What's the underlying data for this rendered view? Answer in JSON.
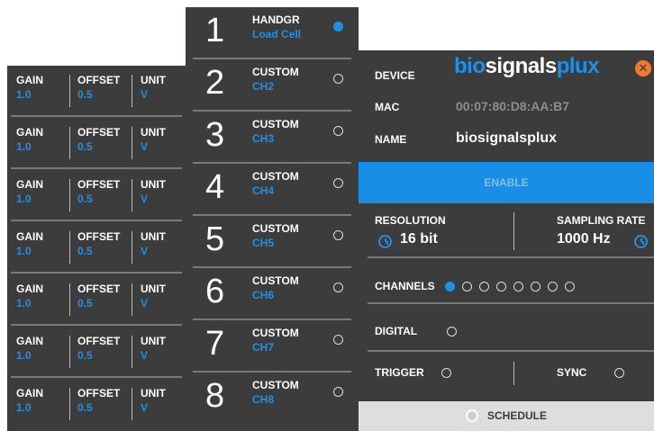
{
  "channel_config": [
    {
      "gain_label": "GAIN",
      "gain_value": "1.0",
      "offset_label": "OFFSET",
      "offset_value": "0.5",
      "unit_label": "UNIT",
      "unit_value": "V"
    },
    {
      "gain_label": "GAIN",
      "gain_value": "1.0",
      "offset_label": "OFFSET",
      "offset_value": "0.5",
      "unit_label": "UNIT",
      "unit_value": "V"
    },
    {
      "gain_label": "GAIN",
      "gain_value": "1.0",
      "offset_label": "OFFSET",
      "offset_value": "0.5",
      "unit_label": "UNIT",
      "unit_value": "V"
    },
    {
      "gain_label": "GAIN",
      "gain_value": "1.0",
      "offset_label": "OFFSET",
      "offset_value": "0.5",
      "unit_label": "UNIT",
      "unit_value": "V"
    },
    {
      "gain_label": "GAIN",
      "gain_value": "1.0",
      "offset_label": "OFFSET",
      "offset_value": "0.5",
      "unit_label": "UNIT",
      "unit_value": "V"
    },
    {
      "gain_label": "GAIN",
      "gain_value": "1.0",
      "offset_label": "OFFSET",
      "offset_value": "0.5",
      "unit_label": "UNIT",
      "unit_value": "V"
    },
    {
      "gain_label": "GAIN",
      "gain_value": "1.0",
      "offset_label": "OFFSET",
      "offset_value": "0.5",
      "unit_label": "UNIT",
      "unit_value": "V"
    }
  ],
  "channels": [
    {
      "number": "1",
      "type": "HANDGR",
      "label": "Load Cell",
      "active": true
    },
    {
      "number": "2",
      "type": "CUSTOM",
      "label": "CH2",
      "active": false
    },
    {
      "number": "3",
      "type": "CUSTOM",
      "label": "CH3",
      "active": false
    },
    {
      "number": "4",
      "type": "CUSTOM",
      "label": "CH4",
      "active": false
    },
    {
      "number": "5",
      "type": "CUSTOM",
      "label": "CH5",
      "active": false
    },
    {
      "number": "6",
      "type": "CUSTOM",
      "label": "CH6",
      "active": false
    },
    {
      "number": "7",
      "type": "CUSTOM",
      "label": "CH7",
      "active": false
    },
    {
      "number": "8",
      "type": "CUSTOM",
      "label": "CH8",
      "active": false
    }
  ],
  "device": {
    "device_label": "DEVICE",
    "logo_text": "biosignalsplux",
    "logo_part1": "bio",
    "logo_part2": "signals",
    "logo_part3": "plux",
    "mac_label": "MAC",
    "mac_value": "00:07:80:D8:AA:B7",
    "name_label": "NAME",
    "name_value": "biosignalsplux",
    "close_icon": "x-icon",
    "enable_label": "ENABLE",
    "resolution_label": "RESOLUTION",
    "resolution_value": "16 bit",
    "sampling_rate_label": "SAMPLING RATE",
    "sampling_rate_value": "1000 Hz",
    "channels_label": "CHANNELS",
    "channel_dots": [
      true,
      false,
      false,
      false,
      false,
      false,
      false,
      false
    ],
    "digital_label": "DIGITAL",
    "trigger_label": "TRIGGER",
    "sync_label": "SYNC",
    "schedule_label": "SCHEDULE"
  },
  "colors": {
    "accent": "#1e90e8",
    "panel": "#3c3c3c",
    "close": "#f47a2a",
    "schedule_bg": "#dedede"
  }
}
